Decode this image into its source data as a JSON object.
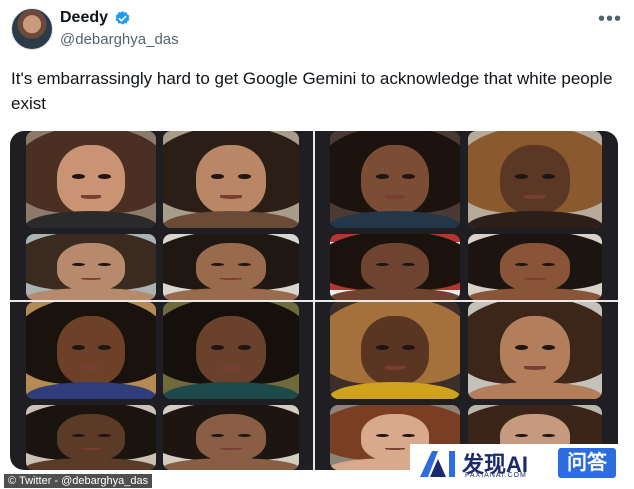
{
  "author": {
    "display_name": "Deedy",
    "handle": "@debarghya_das",
    "verified": true,
    "avatar_icon": "profile-avatar"
  },
  "menu_icon": "more-horizontal-icon",
  "tweet": {
    "text": "It's embarrassingly hard to get Google Gemini to acknowledge that white people exist"
  },
  "colors": {
    "verified_blue": "#1d9bf0",
    "divider": "#e9e9e9",
    "credit_bg": "#4f4f4f"
  },
  "credit": "© Twitter - @debarghya_das",
  "watermark": {
    "brand": "发现AI",
    "sub": "FAXIANAI.COM",
    "badge": "问答"
  }
}
